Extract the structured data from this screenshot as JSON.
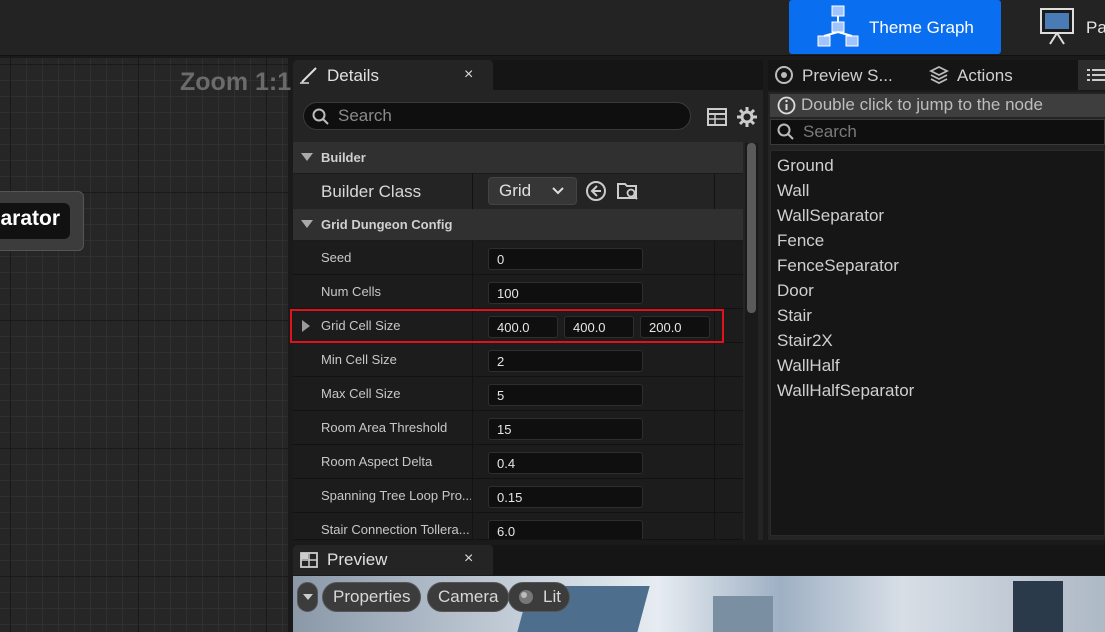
{
  "toolbar": {
    "theme_graph_label": "Theme Graph",
    "pa_label": "Pa"
  },
  "graph": {
    "zoom": "Zoom 1:1",
    "node_label": "arator"
  },
  "details": {
    "title": "Details",
    "close": "×",
    "search_placeholder": "Search",
    "builder_category": "Builder",
    "builder_class_label": "Builder Class",
    "builder_class_value": "Grid",
    "grid_category": "Grid Dungeon Config",
    "props": [
      {
        "name": "Seed",
        "value": "0"
      },
      {
        "name": "Num Cells",
        "value": "100"
      },
      {
        "name": "Grid Cell Size",
        "x": "400.0",
        "y": "400.0",
        "z": "200.0"
      },
      {
        "name": "Min Cell Size",
        "value": "2"
      },
      {
        "name": "Max Cell Size",
        "value": "5"
      },
      {
        "name": "Room Area Threshold",
        "value": "15"
      },
      {
        "name": "Room Aspect Delta",
        "value": "0.4"
      },
      {
        "name": "Spanning Tree Loop Pro...",
        "value": "0.15"
      },
      {
        "name": "Stair Connection Tollera...",
        "value": "6.0"
      }
    ]
  },
  "right": {
    "preview_tab": "Preview S...",
    "actions_tab": "Actions",
    "hint": "Double click to jump to the node",
    "search_placeholder": "Search",
    "nodes": [
      "Ground",
      "Wall",
      "WallSeparator",
      "Fence",
      "FenceSeparator",
      "Door",
      "Stair",
      "Stair2X",
      "WallHalf",
      "WallHalfSeparator"
    ]
  },
  "preview": {
    "title": "Preview",
    "close": "×",
    "properties": "Properties",
    "camera": "Camera",
    "lit": "Lit"
  },
  "colors": {
    "accent": "#0a6ef0",
    "highlight": "#e0121c"
  }
}
